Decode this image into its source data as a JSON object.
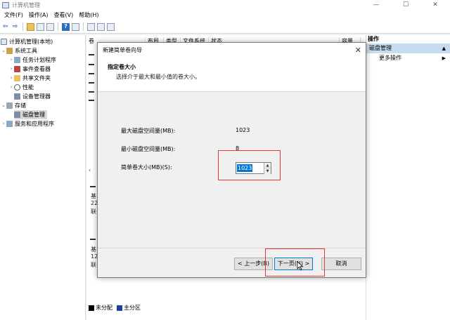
{
  "window": {
    "title": "计算机管理",
    "minimize": "—",
    "maximize": "☐",
    "close": "✕"
  },
  "menu": [
    "文件(F)",
    "操作(A)",
    "查看(V)",
    "帮助(H)"
  ],
  "tree": {
    "root": "计算机管理(本地)",
    "system_tools": "系统工具",
    "task_scheduler": "任务计划程序",
    "event_viewer": "事件查看器",
    "shared_folders": "共享文件夹",
    "performance": "性能",
    "device_manager": "设备管理器",
    "storage": "存储",
    "disk_management": "磁盘管理",
    "services_apps": "服务和应用程序"
  },
  "columns": [
    "卷",
    "布局",
    "类型",
    "文件系统",
    "状态",
    "容量"
  ],
  "actions": {
    "header": "操作",
    "selected": "磁盘管理",
    "more": "更多操作"
  },
  "background": {
    "disk_row1": [
      "基",
      "22",
      "联"
    ],
    "disk_row2": [
      "基",
      "12",
      "联"
    ],
    "legend_unallocated": "未分配",
    "legend_primary": "主分区"
  },
  "dialog": {
    "title": "新建简单卷向导",
    "close": "✕",
    "heading": "指定卷大小",
    "subheading": "选择介于最大和最小值的卷大小。",
    "max_label": "最大磁盘空间量(MB):",
    "max_value": "1023",
    "min_label": "最小磁盘空间量(MB):",
    "min_value": "8",
    "size_label": "简单卷大小(MB)(S):",
    "size_value": "1023",
    "back_button": "< 上一步(B)",
    "next_button": "下一页(N) >",
    "cancel_button": "取消"
  },
  "colors": {
    "highlight_red": "#e23a3a",
    "selection_blue": "#0078d7",
    "action_selected": "#c7dcef"
  }
}
